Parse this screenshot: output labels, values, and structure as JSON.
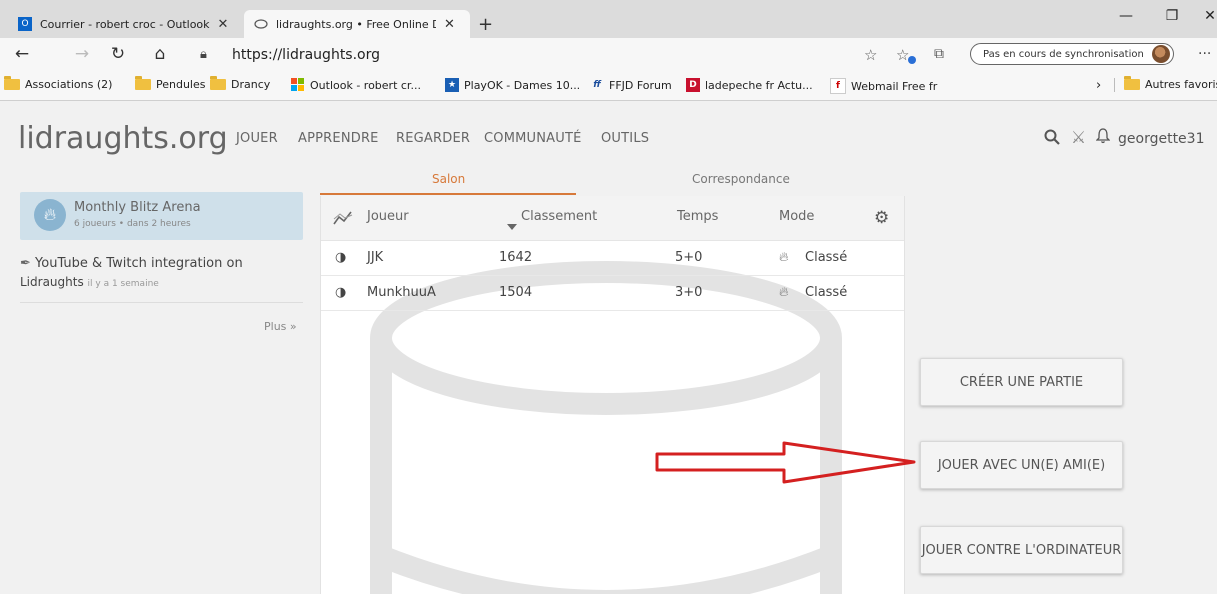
{
  "browser": {
    "tabs": [
      {
        "title": "Courrier - robert croc - Outlook",
        "favicon": "outlook-icon"
      },
      {
        "title": "lidraughts.org • Free Online Dra",
        "favicon": "globe-icon"
      }
    ],
    "address": {
      "url": "https://lidraughts.org"
    },
    "sync_label": "Pas en cours de synchronisation",
    "bookmarks": [
      {
        "label": "Associations (2)",
        "icon": "folder-icon"
      },
      {
        "label": "Pendules",
        "icon": "folder-icon"
      },
      {
        "label": "Drancy",
        "icon": "folder-icon"
      },
      {
        "label": "Outlook - robert cr...",
        "icon": "windows-icon"
      },
      {
        "label": "PlayOK - Dames 10...",
        "icon": "star-icon"
      },
      {
        "label": "FFJD Forum",
        "icon": "ffjd-icon"
      },
      {
        "label": "ladepeche fr  Actu...",
        "icon": "ladepeche-icon"
      },
      {
        "label": "Webmail Free fr",
        "icon": "free-icon"
      },
      {
        "label": "Autres favoris",
        "icon": "folder-icon"
      }
    ]
  },
  "site": {
    "logo": "lidraughts.org",
    "nav": [
      "JOUER",
      "APPRENDRE",
      "REGARDER",
      "COMMUNAUTÉ",
      "OUTILS"
    ],
    "username": "georgette31"
  },
  "sidebar": {
    "event": {
      "title": "Monthly Blitz Arena",
      "subtitle": "6 joueurs • dans 2 heures"
    },
    "blog": {
      "line1": "YouTube & Twitch integration on",
      "line2": "Lidraughts",
      "time": "il y a 1 semaine"
    },
    "more": "Plus »"
  },
  "lobby": {
    "tabs": [
      "Salon",
      "Correspondance"
    ],
    "headers": {
      "player": "Joueur",
      "rating": "Classement",
      "time": "Temps",
      "mode": "Mode"
    },
    "rows": [
      {
        "player": "JJK",
        "rating": "1642",
        "time": "5+0",
        "mode": "Classé"
      },
      {
        "player": "MunkhuuA",
        "rating": "1504",
        "time": "3+0",
        "mode": "Classé"
      }
    ]
  },
  "actions": {
    "create": "CRÉER UNE PARTIE",
    "friend": "JOUER AVEC UN(E) AMI(E)",
    "computer": "JOUER CONTRE L'ORDINATEUR"
  },
  "colors": {
    "accent": "#d7793a",
    "arrow": "#d42020"
  }
}
